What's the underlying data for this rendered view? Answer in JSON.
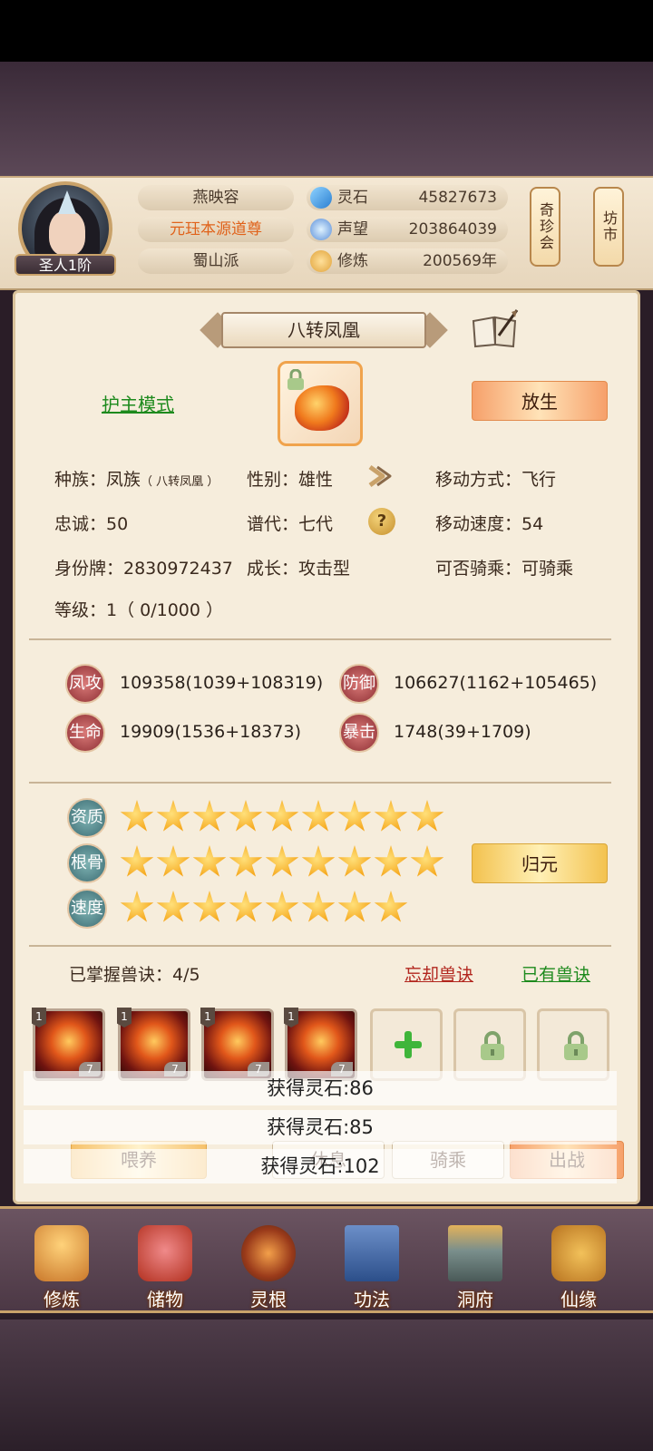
{
  "header": {
    "rank": "圣人1阶",
    "name": "燕映容",
    "title": "元珏本源道尊",
    "sect": "蜀山派",
    "resources": [
      {
        "name": "灵石",
        "value": "45827673",
        "icon": "spirit-stone-icon",
        "color": "#3aa7e8"
      },
      {
        "name": "声望",
        "value": "203864039",
        "icon": "prestige-icon",
        "color": "#5b8fd8"
      },
      {
        "name": "修炼",
        "value": "200569年",
        "icon": "meditation-icon",
        "color": "#e0a23a"
      }
    ],
    "side_buttons": [
      "奇珍会",
      "坊市"
    ]
  },
  "pet": {
    "name": "八转凤凰",
    "mode_link": "护主模式",
    "release_button": "放生",
    "info": {
      "race_label": "种族：凤族",
      "race_sub": "（ 八转凤凰 ）",
      "gender": "性别：雄性",
      "move_type": "移动方式：飞行",
      "loyalty": "忠诚：50",
      "generation": "谱代：七代",
      "move_speed": "移动速度：54",
      "id_tag": "身份牌：2830972437",
      "growth": "成长：攻击型",
      "rideable": "可否骑乘：可骑乘",
      "level": "等级：1（ 0/1000 ）"
    },
    "stats": [
      {
        "badge": "凤攻",
        "value": "109358(1039+108319)"
      },
      {
        "badge": "防御",
        "value": "106627(1162+105465)"
      },
      {
        "badge": "生命",
        "value": "19909(1536+18373)"
      },
      {
        "badge": "暴击",
        "value": "1748(39+1709)"
      }
    ],
    "qualities": [
      {
        "badge": "资质",
        "stars": 9
      },
      {
        "badge": "根骨",
        "stars": 9
      },
      {
        "badge": "速度",
        "stars": 8
      }
    ],
    "return_button": "归元",
    "mastered": "已掌握兽诀：4/5",
    "forget_link": "忘却兽诀",
    "owned_link": "已有兽诀",
    "skills": [
      {
        "level": "1",
        "count": "7"
      },
      {
        "level": "1",
        "count": "7"
      },
      {
        "level": "1",
        "count": "7"
      },
      {
        "level": "1",
        "count": "7"
      }
    ],
    "actions": [
      "喂养",
      "休息",
      "骑乘",
      "出战"
    ]
  },
  "toasts": [
    "获得灵石:86",
    "获得灵石:85",
    "获得灵石:102"
  ],
  "nav": [
    "修炼",
    "储物",
    "灵根",
    "功法",
    "洞府",
    "仙缘"
  ]
}
